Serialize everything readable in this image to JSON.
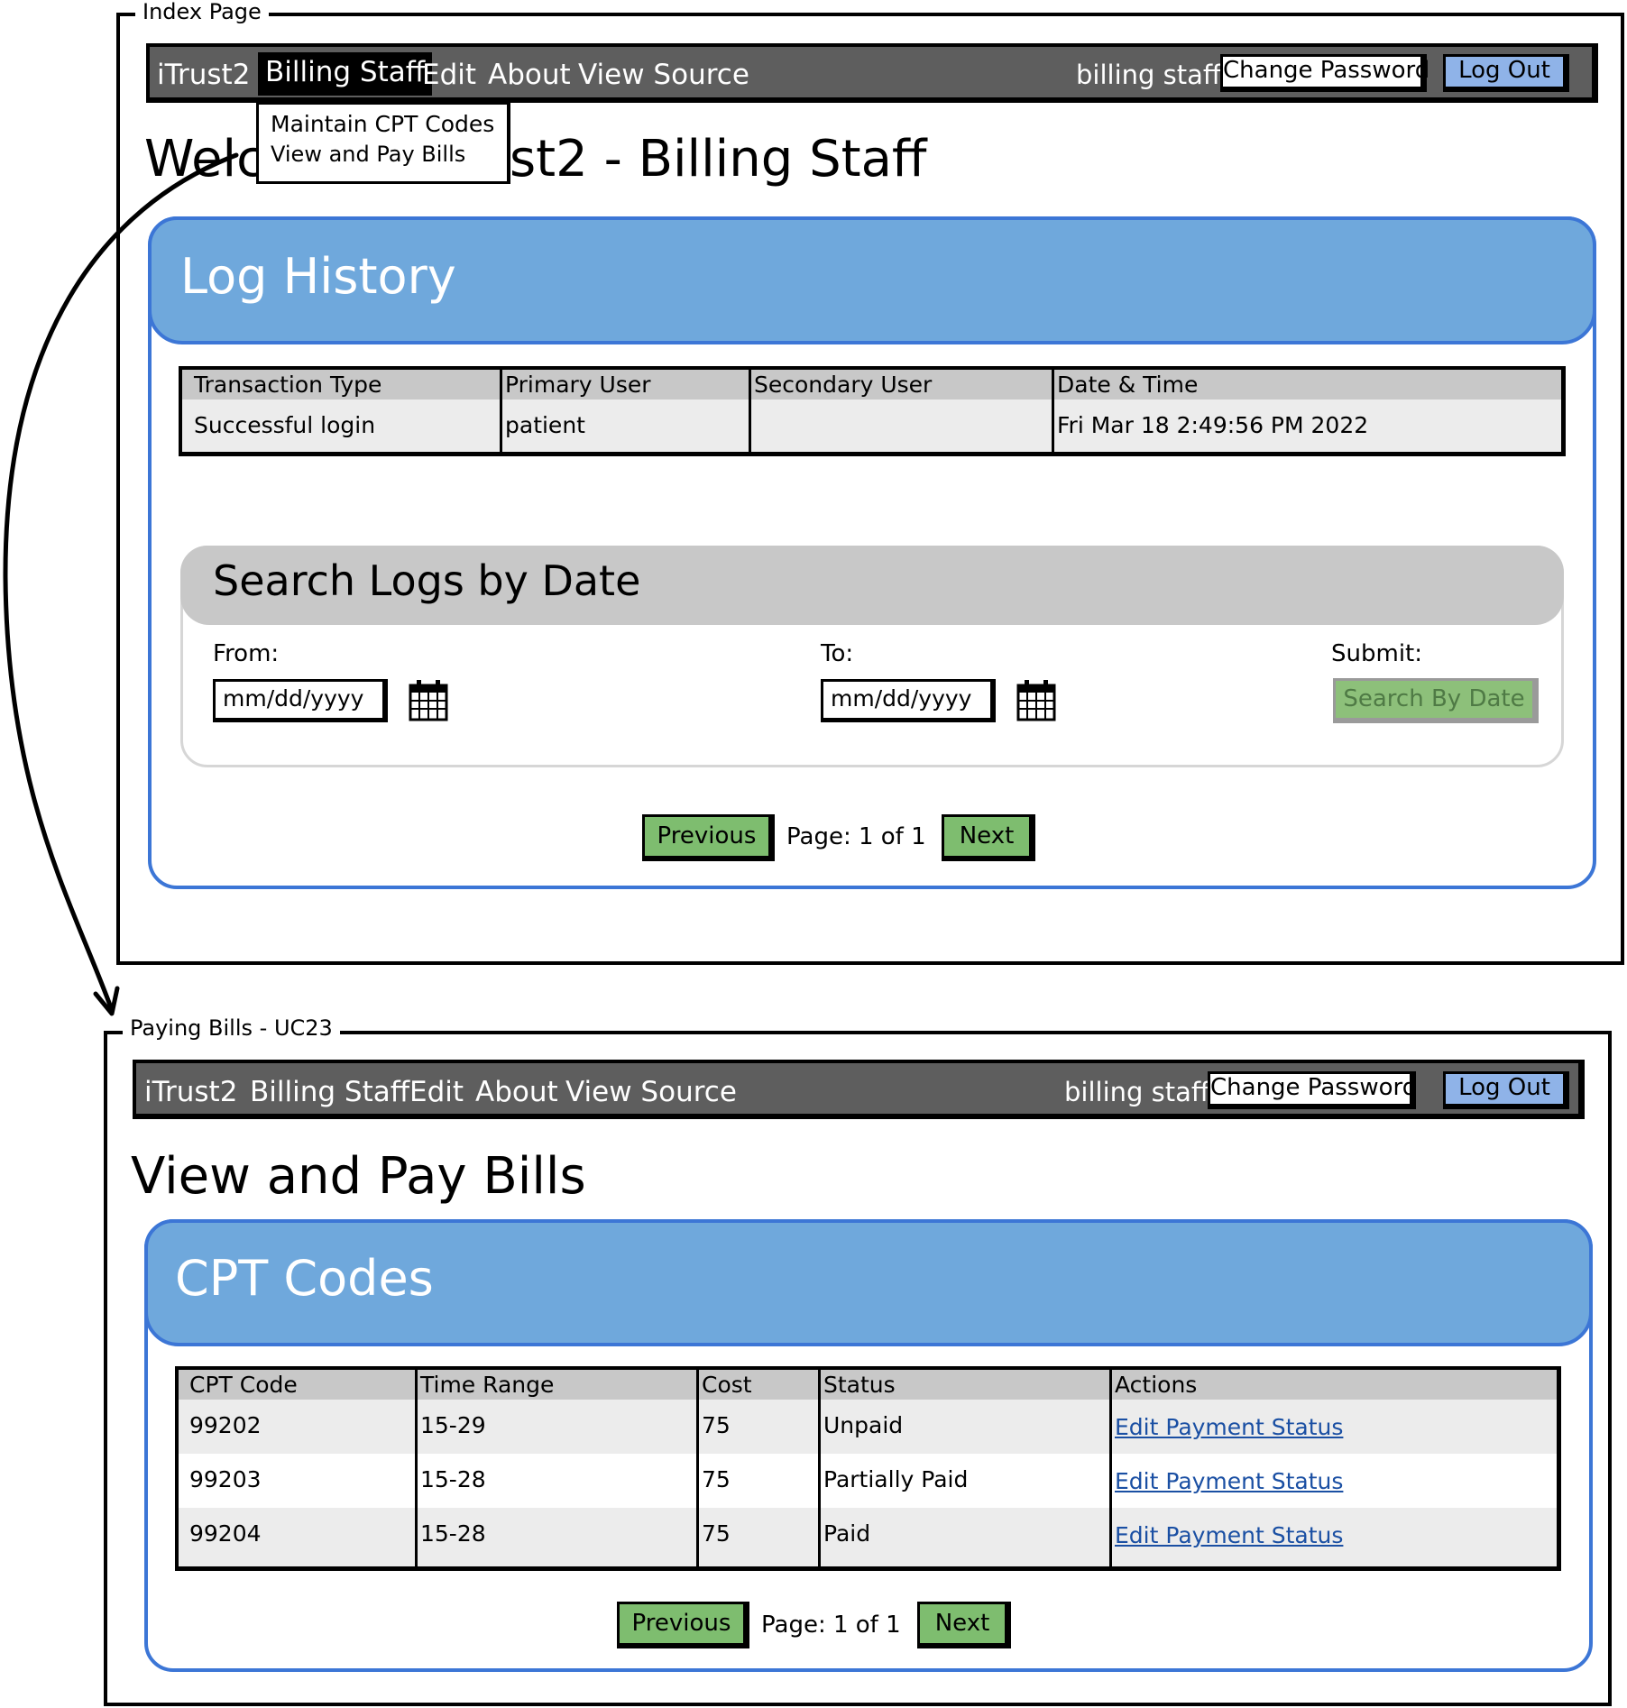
{
  "index_page": {
    "frame_title": "Index Page",
    "navbar": {
      "brand": "iTrust2",
      "items": [
        "Billing Staff",
        "Edit",
        "About",
        "View Source"
      ],
      "user": "billing staff",
      "change_password": "Change Password",
      "log_out": "Log Out"
    },
    "dropdown": {
      "items": [
        "Maintain CPT Codes",
        "View and Pay Bills"
      ]
    },
    "heading_left": "Welc",
    "heading_right": "st2 - Billing Staff",
    "log_panel": {
      "title": "Log History",
      "columns": [
        "Transaction Type",
        "Primary User",
        "Secondary User",
        "Date & Time"
      ],
      "rows": [
        [
          "Successful login",
          "patient",
          "",
          "Fri Mar 18 2:49:56 PM 2022"
        ]
      ]
    },
    "search": {
      "title": "Search Logs by Date",
      "from_label": "From:",
      "to_label": "To:",
      "submit_label": "Submit:",
      "from_placeholder": "mm/dd/yyyy",
      "to_placeholder": "mm/dd/yyyy",
      "search_button": "Search By Date"
    },
    "pagination": {
      "previous": "Previous",
      "page_text": "Page: 1 of 1",
      "next": "Next"
    }
  },
  "bills_page": {
    "frame_title": "Paying Bills - UC23",
    "navbar": {
      "brand": "iTrust2",
      "items": [
        "Billing Staff",
        "Edit",
        "About",
        "View Source"
      ],
      "user": "billing staff",
      "change_password": "Change Password",
      "log_out": "Log Out"
    },
    "heading": "View and Pay Bills",
    "cpt_panel": {
      "title": "CPT Codes",
      "columns": [
        "CPT Code",
        "Time Range",
        "Cost",
        "Status",
        "Actions"
      ],
      "rows": [
        [
          "99202",
          "15-29",
          "75",
          "Unpaid",
          "Edit Payment Status"
        ],
        [
          "99203",
          "15-28",
          "75",
          "Partially Paid",
          "Edit Payment Status"
        ],
        [
          "99204",
          "15-28",
          "75",
          "Paid",
          "Edit Payment Status"
        ]
      ]
    },
    "pagination": {
      "previous": "Previous",
      "page_text": "Page: 1 of 1",
      "next": "Next"
    }
  },
  "colors": {
    "navbar": "#5e5e5e",
    "panel_header": "#6fa8dc",
    "panel_border": "#3c76d6",
    "button_green": "#7ebd6f",
    "button_blue": "#8fb3e8",
    "link": "#1a4fa3"
  }
}
